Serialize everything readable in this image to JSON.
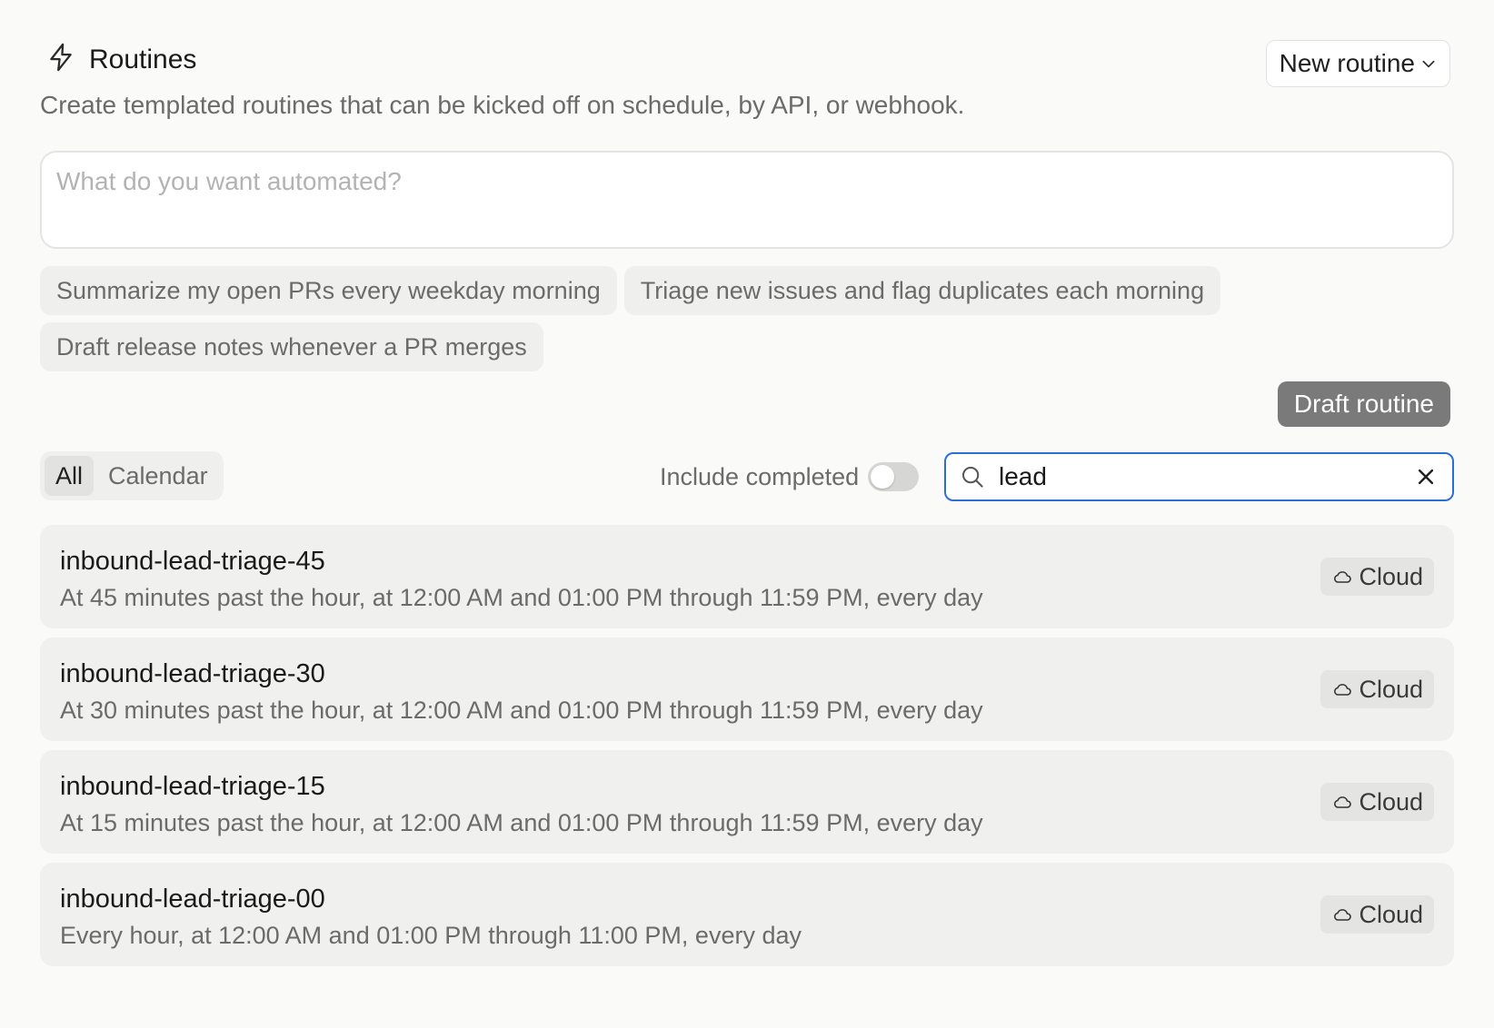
{
  "header": {
    "title": "Routines",
    "subtitle": "Create templated routines that can be kicked off on schedule, by API, or webhook.",
    "new_routine_label": "New routine",
    "icon": "lightning-icon"
  },
  "prompt": {
    "placeholder": "What do you want automated?",
    "value": ""
  },
  "suggestions": [
    "Summarize my open PRs every weekday morning",
    "Triage new issues and flag duplicates each morning",
    "Draft release notes whenever a PR merges"
  ],
  "draft_button_label": "Draft routine",
  "filters": {
    "tabs": [
      "All",
      "Calendar"
    ],
    "active_tab": "All",
    "include_completed_label": "Include completed",
    "include_completed": false
  },
  "search": {
    "value": "lead",
    "placeholder": ""
  },
  "routines": [
    {
      "name": "inbound-lead-triage-45",
      "schedule": "At 45 minutes past the hour, at 12:00 AM and 01:00 PM through 11:59 PM, every day",
      "badge": "Cloud"
    },
    {
      "name": "inbound-lead-triage-30",
      "schedule": "At 30 minutes past the hour, at 12:00 AM and 01:00 PM through 11:59 PM, every day",
      "badge": "Cloud"
    },
    {
      "name": "inbound-lead-triage-15",
      "schedule": "At 15 minutes past the hour, at 12:00 AM and 01:00 PM through 11:59 PM, every day",
      "badge": "Cloud"
    },
    {
      "name": "inbound-lead-triage-00",
      "schedule": "Every hour, at 12:00 AM and 01:00 PM through 11:00 PM, every day",
      "badge": "Cloud"
    }
  ],
  "colors": {
    "background": "#fafaf9",
    "search_focus": "#2a6fd6",
    "draft_button": "#7a7a7a"
  }
}
